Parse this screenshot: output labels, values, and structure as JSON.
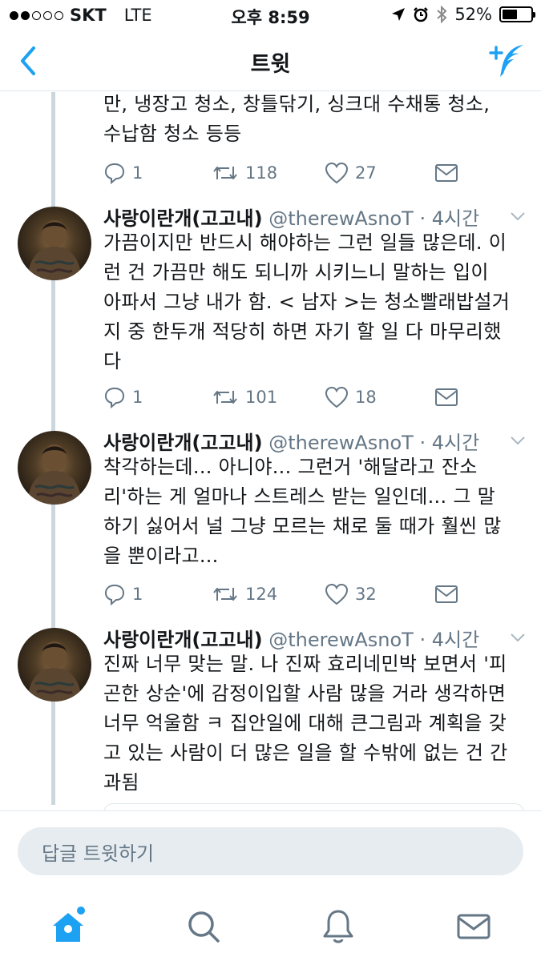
{
  "status_bar": {
    "carrier": "SKT",
    "network": "LTE",
    "time": "오후 8:59",
    "battery_percent": "52%",
    "battery_level": 0.52,
    "signal_bars_on": 2,
    "signal_bars_total": 5
  },
  "nav": {
    "title": "트윗",
    "back_icon": "chevron-left-icon",
    "compose_icon": "compose-feather-icon",
    "accent_color": "#1da1f2"
  },
  "tweets": [
    {
      "text": "만, 냉장고 청소, 창틀닦기, 싱크대 수채통 청소,\n수납함 청소 등등",
      "replies": "1",
      "retweets": "118",
      "likes": "27"
    },
    {
      "name": "사랑이란개(고고내)",
      "handle": "@therewAsnoT",
      "time": "· 4시간",
      "text": "가끔이지만 반드시 해야하는 그런 일들 많은데. 이\n런 건 가끔만 해도 되니까 시키느니 말하는 입이\n아파서 그냥 내가 함. < 남자 >는 청소빨래밥설거\n지 중 한두개 적당히 하면 자기 할 일 다 마무리했\n다",
      "replies": "1",
      "retweets": "101",
      "likes": "18"
    },
    {
      "name": "사랑이란개(고고내)",
      "handle": "@therewAsnoT",
      "time": "· 4시간",
      "text": "착각하는데... 아니야... 그런거 '해달라고 잔소\n리'하는 게 얼마나 스트레스 받는 일인데... 그 말\n하기 싫어서 널 그냥 모르는 채로 둘 때가 훨씬 많\n을 뿐이라고...",
      "replies": "1",
      "retweets": "124",
      "likes": "32"
    },
    {
      "name": "사랑이란개(고고내)",
      "handle": "@therewAsnoT",
      "time": "· 4시간",
      "text": "진짜 너무 맞는 말. 나 진짜 효리네민박 보면서 '피\n곤한 상순'에 감정이입할 사람 많을 거라 생각하면\n너무 억울함 ㅋ 집안일에 대해 큰그림과 계획을 갖\n고 있는 사람이 더 많은 일을 할 수밖에 없는 건 간\n과됨"
    }
  ],
  "reply_bar": {
    "placeholder": "답글 트윗하기"
  },
  "tab_bar": {
    "items": [
      "home-icon",
      "search-icon",
      "notifications-bell-icon",
      "messages-envelope-icon"
    ],
    "active": "home-icon"
  }
}
